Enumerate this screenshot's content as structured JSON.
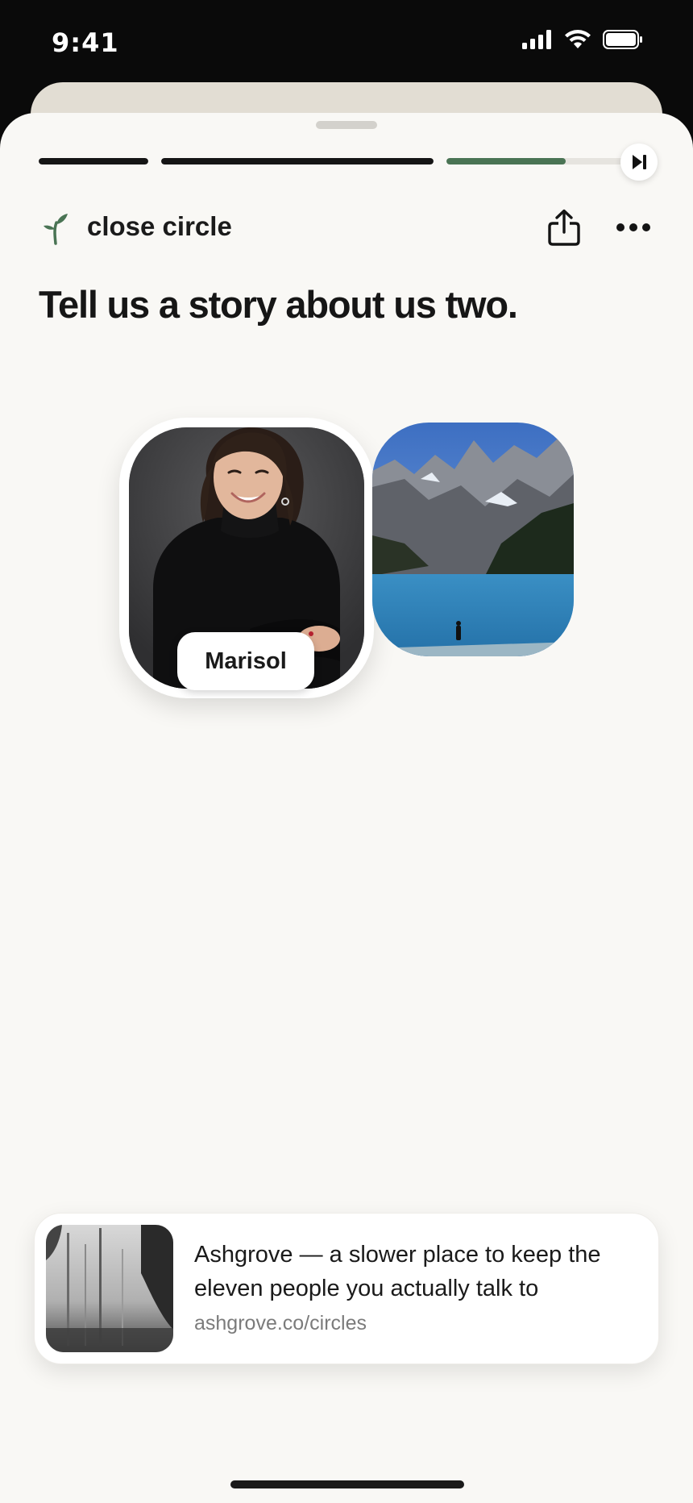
{
  "status_bar": {
    "time": "9:41"
  },
  "story": {
    "progress": [
      1.0,
      1.0,
      0.65
    ],
    "circle_name": "close circle",
    "prompt": "Tell us a story about us two.",
    "person": {
      "name": "Marisol"
    }
  },
  "link_preview": {
    "title": "Ashgrove — a slower place to keep the eleven people you actually talk to",
    "url": "ashgrove.co/circles"
  },
  "colors": {
    "accent": "#4a7454",
    "sheet_bg": "#f9f8f5",
    "progress_done": "#151515",
    "progress_track": "#e6e4df"
  },
  "icons": [
    "signal-icon",
    "wifi-icon",
    "battery-icon",
    "skip-next-icon",
    "sprout-icon",
    "share-icon",
    "more-icon"
  ]
}
